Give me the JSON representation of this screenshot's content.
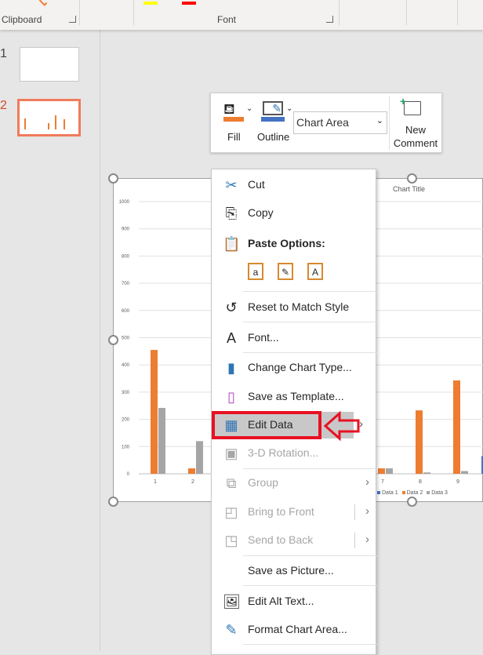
{
  "ribbon": {
    "groups": [
      {
        "label": "Clipboard"
      },
      {
        "label": "Font"
      }
    ]
  },
  "slides": [
    {
      "number": "1"
    },
    {
      "number": "2",
      "selected": true
    }
  ],
  "mini_toolbar": {
    "fill_label": "Fill",
    "outline_label": "Outline",
    "element_select": "Chart Area",
    "new_comment_label": "New Comment",
    "fill_color": "#ed7d31",
    "outline_color": "#4472c4"
  },
  "context_menu": {
    "items": [
      {
        "label": "Cut",
        "icon": "scissors-icon",
        "enabled": true
      },
      {
        "label": "Copy",
        "icon": "copy-icon",
        "enabled": true
      },
      {
        "label": "Paste Options:",
        "icon": "paste-icon",
        "enabled": true,
        "bold": true
      },
      {
        "label": "Reset to Match Style",
        "icon": "reset-icon",
        "enabled": true
      },
      {
        "label": "Font...",
        "icon": "font-icon",
        "enabled": true
      },
      {
        "label": "Change Chart Type...",
        "icon": "chart-type-icon",
        "enabled": true
      },
      {
        "label": "Save as Template...",
        "icon": "save-template-icon",
        "enabled": true
      },
      {
        "label": "Edit Data",
        "icon": "edit-data-icon",
        "enabled": true,
        "highlighted": true
      },
      {
        "label": "3-D Rotation...",
        "icon": "3d-rotation-icon",
        "enabled": false
      },
      {
        "label": "Group",
        "icon": "group-icon",
        "enabled": false,
        "submenu": true
      },
      {
        "label": "Bring to Front",
        "icon": "bring-front-icon",
        "enabled": false,
        "submenu": true
      },
      {
        "label": "Send to Back",
        "icon": "send-back-icon",
        "enabled": false,
        "submenu": true
      },
      {
        "label": "Save as Picture...",
        "icon": "",
        "enabled": true
      },
      {
        "label": "Edit Alt Text...",
        "icon": "alt-text-icon",
        "enabled": true
      },
      {
        "label": "Format Chart Area...",
        "icon": "format-icon",
        "enabled": true
      }
    ],
    "paste_icons": [
      "paste-keep-source-icon",
      "paste-merge-format-icon",
      "paste-text-only-icon"
    ]
  },
  "annotation": {
    "color": "#e81123",
    "highlights": "Edit Data"
  },
  "chart_data": {
    "type": "bar",
    "title": "Chart Title",
    "ylim": [
      0,
      1000
    ],
    "yticks": [
      0,
      100,
      200,
      300,
      400,
      500,
      600,
      700,
      800,
      900,
      1000
    ],
    "grid": true,
    "legend": "bottom",
    "categories": [
      "1",
      "2",
      "7",
      "8",
      "9"
    ],
    "series": [
      {
        "name": "Data 1",
        "color": "#4472c4",
        "values": [
          0,
          0,
          0,
          0,
          0
        ]
      },
      {
        "name": "Data 2",
        "color": "#ed7d31",
        "values": [
          455,
          20,
          20,
          233,
          343
        ]
      },
      {
        "name": "Data 3",
        "color": "#a5a5a5",
        "values": [
          242,
          120,
          20,
          5,
          10
        ]
      }
    ]
  }
}
